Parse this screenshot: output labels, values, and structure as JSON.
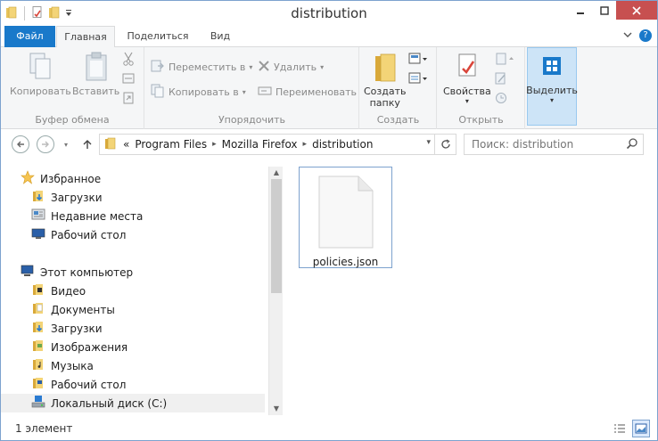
{
  "window": {
    "title": "distribution"
  },
  "tabs": {
    "file": "Файл",
    "home": "Главная",
    "share": "Поделиться",
    "view": "Вид"
  },
  "ribbon": {
    "clipboard": {
      "label": "Буфер обмена",
      "copy": "Копировать",
      "paste": "Вставить"
    },
    "organize": {
      "label": "Упорядочить",
      "move_to": "Переместить в",
      "copy_to": "Копировать в",
      "delete": "Удалить",
      "rename": "Переименовать"
    },
    "new": {
      "label": "Создать",
      "new_folder_line1": "Создать",
      "new_folder_line2": "папку"
    },
    "open": {
      "label": "Открыть",
      "properties": "Свойства"
    },
    "select": {
      "label": "Выделить"
    }
  },
  "address": {
    "prefix": "«",
    "crumbs": [
      "Program Files",
      "Mozilla Firefox",
      "distribution"
    ]
  },
  "search": {
    "placeholder": "Поиск: distribution"
  },
  "nav": {
    "favorites": "Избранное",
    "downloads": "Загрузки",
    "recent": "Недавние места",
    "desktop": "Рабочий стол",
    "this_pc": "Этот компьютер",
    "video": "Видео",
    "documents": "Документы",
    "downloads2": "Загрузки",
    "pictures": "Изображения",
    "music": "Музыка",
    "desktop2": "Рабочий стол",
    "local_disk": "Локальный диск (C:)"
  },
  "files": [
    {
      "name": "policies.json"
    }
  ],
  "status": {
    "count": "1 элемент"
  },
  "colors": {
    "accent": "#1979ca",
    "close": "#c75050",
    "selection": "#cde4f7",
    "folder": "#e8c35a"
  }
}
